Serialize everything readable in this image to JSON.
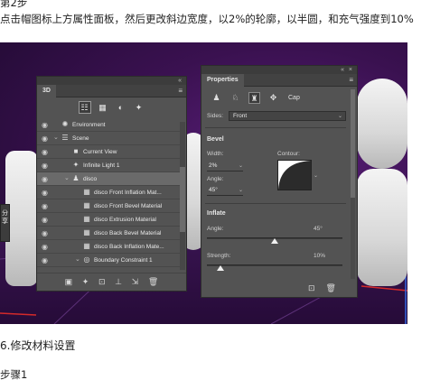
{
  "header": {
    "step": "第2步",
    "instruction": "点击帽图标上方属性面板，然后更改斜边宽度，以2%的轮廓，以半圆，和充气强度到10%"
  },
  "footer": {
    "section": "6.修改材料设置",
    "step": "步骤1"
  },
  "side_tab": {
    "line1": "分",
    "line2": "享"
  },
  "panel3d": {
    "collapse": "«",
    "title": "3D",
    "menu_icon": "hamburger-menu-icon",
    "filters": [
      {
        "name": "filter-scene-icon",
        "glyph": "☷",
        "selected": true
      },
      {
        "name": "filter-mesh-icon",
        "glyph": "▦"
      },
      {
        "name": "filter-material-icon",
        "glyph": "◐"
      },
      {
        "name": "filter-light-icon",
        "glyph": "✦"
      }
    ],
    "rows": [
      {
        "label": "Environment",
        "icon": "environment-icon",
        "glyph": "✺"
      },
      {
        "label": "Scene",
        "icon": "scene-icon",
        "glyph": "☰"
      },
      {
        "label": "Current View",
        "icon": "camera-icon",
        "glyph": "■"
      },
      {
        "label": "Infinite Light 1",
        "icon": "light-icon",
        "glyph": "✦"
      },
      {
        "label": "disco",
        "icon": "mesh-icon",
        "glyph": "♟",
        "selected": true
      },
      {
        "label": "disco Front Inflation Mat...",
        "icon": "material-icon",
        "glyph": "▦"
      },
      {
        "label": "disco Front Bevel Material",
        "icon": "material-icon",
        "glyph": "▦"
      },
      {
        "label": "disco Extrusion Material",
        "icon": "material-icon",
        "glyph": "▦"
      },
      {
        "label": "disco Back Bevel Material",
        "icon": "material-icon",
        "glyph": "▦"
      },
      {
        "label": "disco Back Inflation Mate...",
        "icon": "material-icon",
        "glyph": "▦"
      },
      {
        "label": "Boundary Constraint 1",
        "icon": "constraint-icon",
        "glyph": "◎"
      }
    ],
    "footer_icons": [
      "new-mesh-icon",
      "light-add-icon",
      "render-icon",
      "ground-icon",
      "move-icon",
      "trash-icon"
    ]
  },
  "properties": {
    "collapse": "«",
    "close": "×",
    "title": "Properties",
    "menu_icon": "hamburger-menu-icon",
    "types": [
      {
        "name": "mesh-type-icon",
        "glyph": "♟"
      },
      {
        "name": "deform-type-icon",
        "glyph": "♘"
      },
      {
        "name": "cap-type-icon",
        "glyph": "♜",
        "selected": true
      },
      {
        "name": "coordinates-type-icon",
        "glyph": "✥"
      }
    ],
    "cap_label": "Cap",
    "sides_label": "Sides:",
    "sides_value": "Front",
    "bevel_label": "Bevel",
    "width_label": "Width:",
    "width_value": "2%",
    "contour_label": "Contour:",
    "angle_label": "Angle:",
    "angle_value": "45°",
    "inflate_label": "Inflate",
    "inflate_angle_label": "Angle:",
    "inflate_angle_value": "45°",
    "inflate_angle_level": 0.5,
    "strength_label": "Strength:",
    "strength_value": "10%",
    "strength_level": 0.1,
    "footer_icons": [
      "render-settings-icon",
      "trash-icon"
    ]
  }
}
